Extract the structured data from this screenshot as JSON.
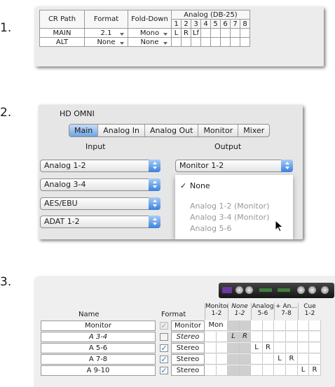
{
  "steps": {
    "one": "1.",
    "two": "2.",
    "three": "3."
  },
  "figure1": {
    "headers": {
      "cr_path": "CR Path",
      "format": "Format",
      "fold_down": "Fold-Down",
      "analog": "Analog (DB-25)"
    },
    "channel_numbers": [
      "1",
      "2",
      "3",
      "4",
      "5",
      "6",
      "7",
      "8"
    ],
    "rows": [
      {
        "path": "MAIN",
        "format": "2.1",
        "fold_down": "Mono",
        "ch": [
          "L",
          "R",
          "Lf",
          "",
          "",
          "",
          "",
          ""
        ]
      },
      {
        "path": "ALT",
        "format": "None",
        "fold_down": "None",
        "ch": [
          "",
          "",
          "",
          "",
          "",
          "",
          "",
          ""
        ]
      }
    ]
  },
  "figure2": {
    "device_title": "HD OMNI",
    "tabs": [
      "Main",
      "Analog In",
      "Analog Out",
      "Monitor",
      "Mixer"
    ],
    "active_tab": "Main",
    "input_label": "Input",
    "output_label": "Output",
    "inputs": [
      "Analog 1-2",
      "Analog 3-4",
      "AES/EBU",
      "ADAT 1-2"
    ],
    "output_value": "Monitor 1-2",
    "menu": {
      "check": "✓",
      "items": [
        "None",
        "Analog 1-2 (Monitor)",
        "Analog 3-4 (Monitor)",
        "Analog 5-6"
      ]
    },
    "accent": "#3b82dd"
  },
  "figure3": {
    "name_header": "Name",
    "format_header": "Format",
    "columns": [
      {
        "l1": "Monitor",
        "l2": "1-2"
      },
      {
        "l1": "None",
        "l2": "1-2"
      },
      {
        "l1": "Analog",
        "l2": "5-6"
      },
      {
        "l1": "+ An...",
        "l2": "7-8"
      },
      {
        "l1": "Cue",
        "l2": "1-2"
      }
    ],
    "rows": [
      {
        "name": "Monitor",
        "check": "✓",
        "format": "Monitor",
        "cells": [
          "Mon",
          "",
          "",
          "",
          "",
          "",
          "",
          "",
          "",
          ""
        ]
      },
      {
        "name": "A 3-4",
        "check": "",
        "format": "Stereo",
        "cells": [
          "",
          "",
          "L",
          "R",
          "",
          "",
          "",
          "",
          "",
          ""
        ]
      },
      {
        "name": "A 5-6",
        "check": "✓",
        "format": "Stereo",
        "cells": [
          "",
          "",
          "",
          "",
          "L",
          "R",
          "",
          "",
          "",
          ""
        ]
      },
      {
        "name": "A 7-8",
        "check": "✓",
        "format": "Stereo",
        "cells": [
          "",
          "",
          "",
          "",
          "",
          "",
          "L",
          "R",
          "",
          ""
        ]
      },
      {
        "name": "A 9-10",
        "check": "✓",
        "format": "Stereo",
        "cells": [
          "",
          "",
          "",
          "",
          "",
          "",
          "",
          "",
          "L",
          "R"
        ]
      }
    ]
  }
}
